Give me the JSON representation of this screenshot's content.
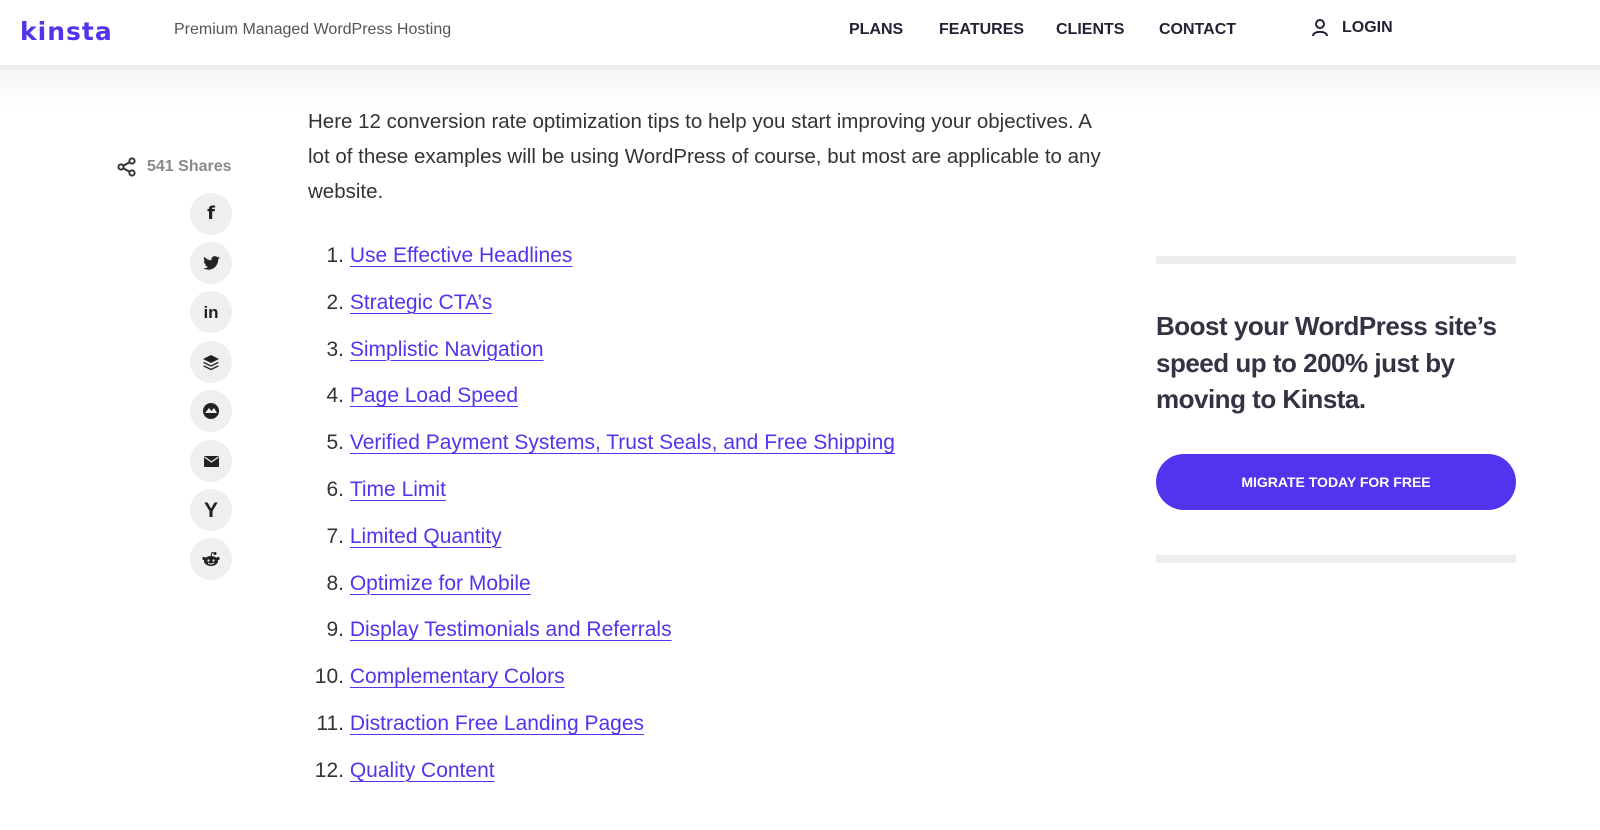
{
  "header": {
    "logo": "kinsta",
    "tagline": "Premium Managed WordPress Hosting",
    "nav": [
      "PLANS",
      "FEATURES",
      "CLIENTS",
      "CONTACT"
    ],
    "login": "LOGIN",
    "login_icon": "user-icon"
  },
  "share": {
    "count": "541 Shares",
    "icon": "share-icon",
    "buttons": [
      {
        "name": "facebook-icon",
        "glyph": "f"
      },
      {
        "name": "twitter-icon",
        "glyph": "🐦"
      },
      {
        "name": "linkedin-icon",
        "glyph": "in"
      },
      {
        "name": "buffer-icon",
        "glyph": "≋"
      },
      {
        "name": "flipboard-icon",
        "glyph": "◕"
      },
      {
        "name": "email-icon",
        "glyph": "✉"
      },
      {
        "name": "hacker-news-icon",
        "glyph": "Y"
      },
      {
        "name": "reddit-icon",
        "glyph": "☻"
      }
    ]
  },
  "article": {
    "intro": "Here 12 conversion rate optimization tips to help you start improving your objectives. A lot of these examples will be using WordPress of course, but most are applicable to any website.",
    "tips": [
      {
        "num": "1.",
        "label": "Use Effective Headlines"
      },
      {
        "num": "2.",
        "label": "Strategic CTA’s"
      },
      {
        "num": "3.",
        "label": "Simplistic Navigation"
      },
      {
        "num": "4.",
        "label": "Page Load Speed"
      },
      {
        "num": "5.",
        "label": "Verified Payment Systems, Trust Seals, and Free Shipping"
      },
      {
        "num": "6.",
        "label": "Time Limit"
      },
      {
        "num": "7.",
        "label": "Limited Quantity"
      },
      {
        "num": "8.",
        "label": "Optimize for Mobile"
      },
      {
        "num": "9.",
        "label": "Display Testimonials and Referrals"
      },
      {
        "num": "10.",
        "label": "Complementary Colors"
      },
      {
        "num": "11.",
        "label": "Distraction Free Landing Pages"
      },
      {
        "num": "12.",
        "label": "Quality Content"
      }
    ]
  },
  "sidebar": {
    "promo_title": "Boost your WordPress site’s speed up to 200% just by moving to Kinsta.",
    "cta_label": "MIGRATE TODAY FOR FREE"
  },
  "colors": {
    "brand": "#5333ed",
    "text": "#333333",
    "social_bg": "#efefef"
  }
}
